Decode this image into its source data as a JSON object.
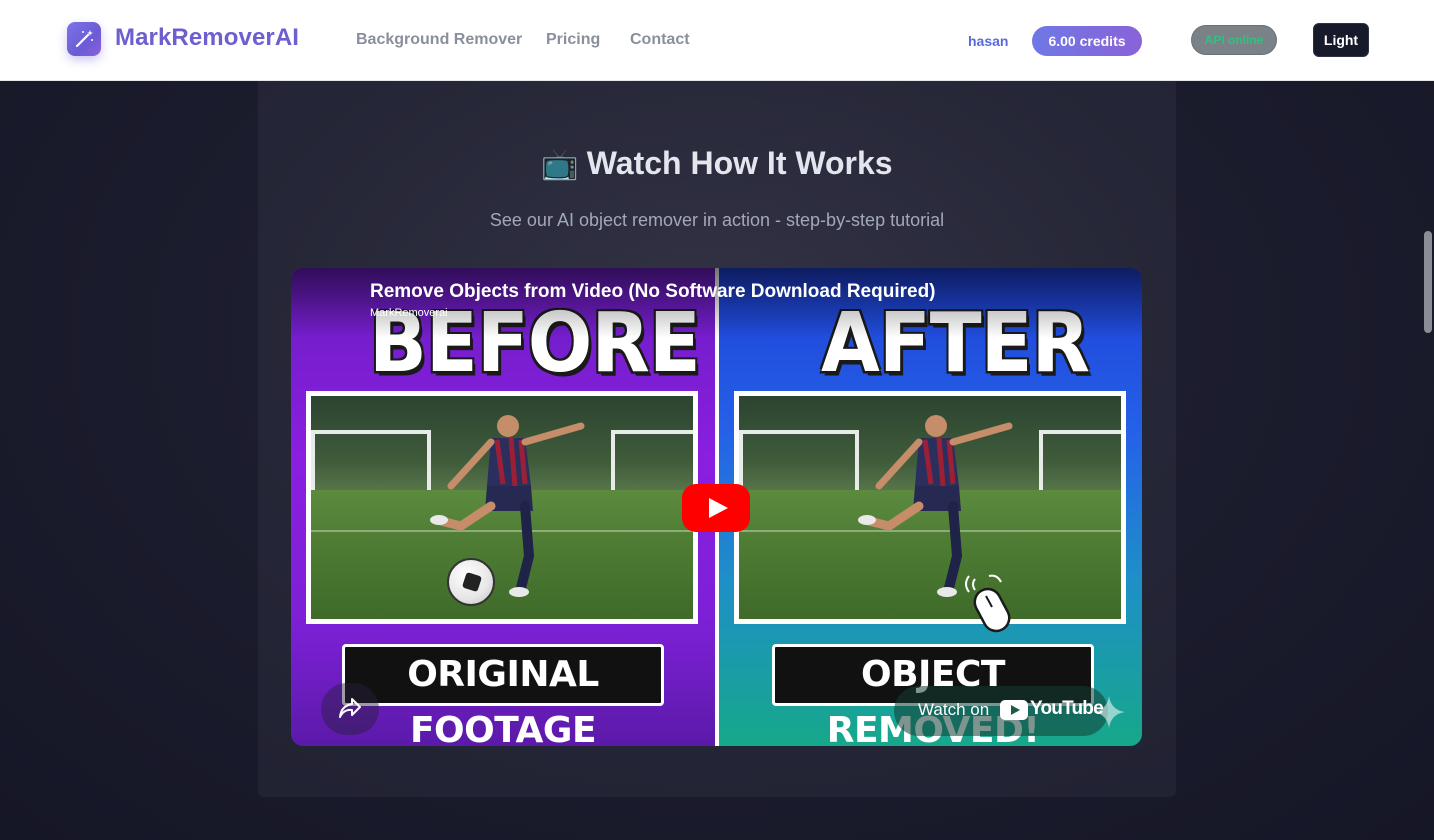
{
  "header": {
    "logo_icon": "magic-wand-icon",
    "brand": "MarkRemoverAI",
    "nav": [
      {
        "label": "Background Remover"
      },
      {
        "label": "Pricing"
      },
      {
        "label": "Contact"
      }
    ],
    "user": "hasan",
    "credits": "6.00 credits",
    "api_status": "API online",
    "theme_toggle": "Light",
    "colors": {
      "brand": "#6c5fcf",
      "accent_gradient_start": "#6f78e6",
      "accent_gradient_end": "#8a62d8",
      "api_online": "#2ec27e"
    }
  },
  "section": {
    "emoji": "📺",
    "title": "Watch How It Works",
    "subtitle": "See our AI object remover in action - step-by-step tutorial"
  },
  "video": {
    "title": "Remove Objects from Video (No Software Download Required)",
    "channel": "MarkRemoverai",
    "thumbnail": {
      "left_heading": "BEFORE",
      "right_heading": "AFTER",
      "left_caption": "ORIGINAL FOOTAGE",
      "right_caption": "OBJECT REMOVED!"
    },
    "play_icon": "youtube-play-icon",
    "share_icon": "share-arrow-icon",
    "watch_on_label": "Watch on",
    "platform": "YouTube"
  }
}
